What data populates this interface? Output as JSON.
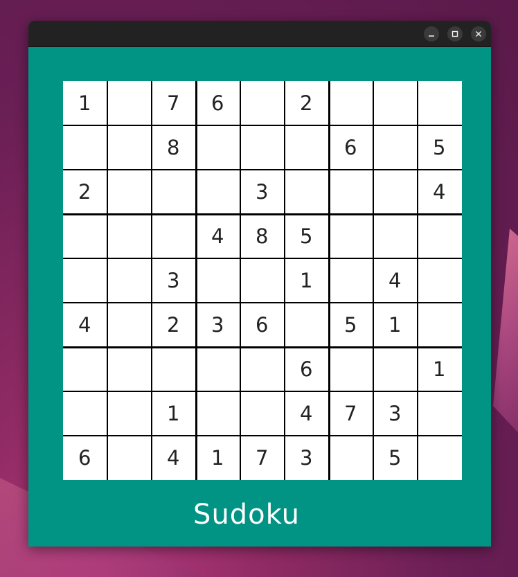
{
  "window": {
    "title": "",
    "controls": {
      "minimize_icon": "minimize-icon",
      "maximize_icon": "maximize-icon",
      "close_icon": "close-icon"
    }
  },
  "app": {
    "title": "Sudoku",
    "background_color": "#019485"
  },
  "grid": [
    [
      "1",
      "",
      "7",
      "6",
      "",
      "2",
      "",
      "",
      ""
    ],
    [
      "",
      "",
      "8",
      "",
      "",
      "",
      "6",
      "",
      "5"
    ],
    [
      "2",
      "",
      "",
      "",
      "3",
      "",
      "",
      "",
      "4"
    ],
    [
      "",
      "",
      "",
      "4",
      "8",
      "5",
      "",
      "",
      ""
    ],
    [
      "",
      "",
      "3",
      "",
      "",
      "1",
      "",
      "4",
      ""
    ],
    [
      "4",
      "",
      "2",
      "3",
      "6",
      "",
      "5",
      "1",
      ""
    ],
    [
      "",
      "",
      "",
      "",
      "",
      "6",
      "",
      "",
      "1"
    ],
    [
      "",
      "",
      "1",
      "",
      "",
      "4",
      "7",
      "3",
      ""
    ],
    [
      "6",
      "",
      "4",
      "1",
      "7",
      "3",
      "",
      "5",
      ""
    ]
  ]
}
